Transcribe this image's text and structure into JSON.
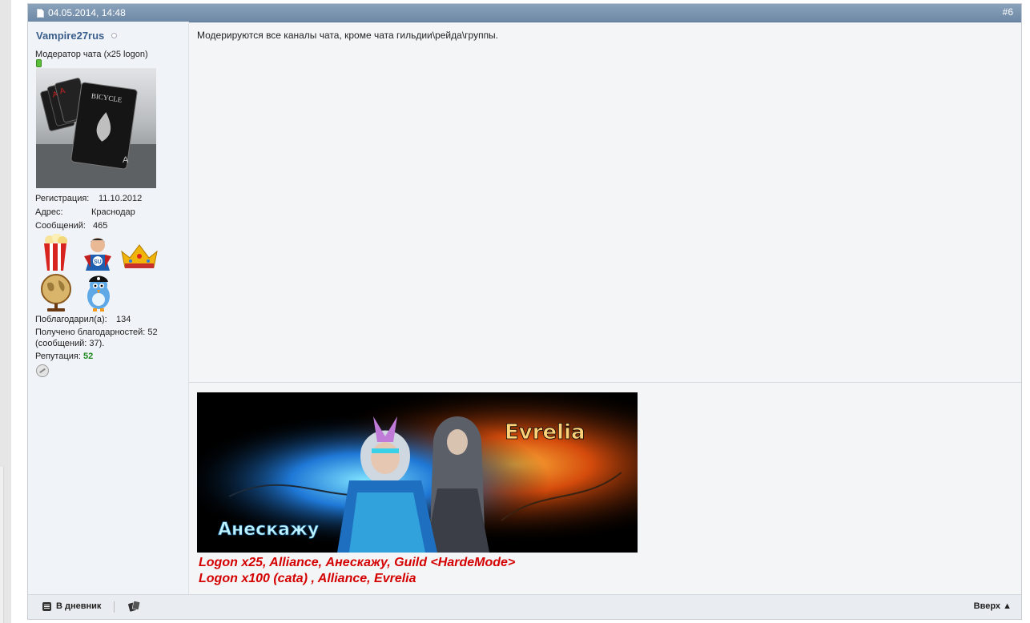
{
  "post": {
    "date": "04.05.2014, 14:48",
    "number": "#6",
    "message": "Модерируются все каналы чата, кроме чата гильдии\\рейда\\группы."
  },
  "user": {
    "name": "Vampire27rus",
    "title": "Модератор чата (x25 logon)",
    "registration_label": "Регистрация:",
    "registration_value": "11.10.2012",
    "address_label": "Адрес:",
    "address_value": "Краснодар",
    "messages_label": "Сообщений:",
    "messages_value": "465",
    "thanked_label": "Поблагодарил(а):",
    "thanked_value": "134",
    "thanks_received_line1": "Получено благодарностей: 52",
    "thanks_received_line2": "(сообщений: 37).",
    "reputation_label": "Репутация:",
    "reputation_value": "52"
  },
  "signature": {
    "banner_name_right": "Evrelia",
    "banner_name_left": "Анескажу",
    "line1": "Logon x25, Alliance, Анескажу, Guild <HardeMode>",
    "line2": "Logon x100 (cata) , Alliance, Evrelia"
  },
  "footer": {
    "blog_label": "В дневник",
    "top_label": "Вверх ▲"
  },
  "icons": {
    "post": "document-icon",
    "status": "offline-dot-icon",
    "pm": "private-message-icon",
    "blog": "blog-icon",
    "quote": "cards-icon"
  },
  "colors": {
    "header": "#7a93ae",
    "username": "#3a5f8c",
    "reputation": "#1e8a1e",
    "signature": "#d40000"
  }
}
